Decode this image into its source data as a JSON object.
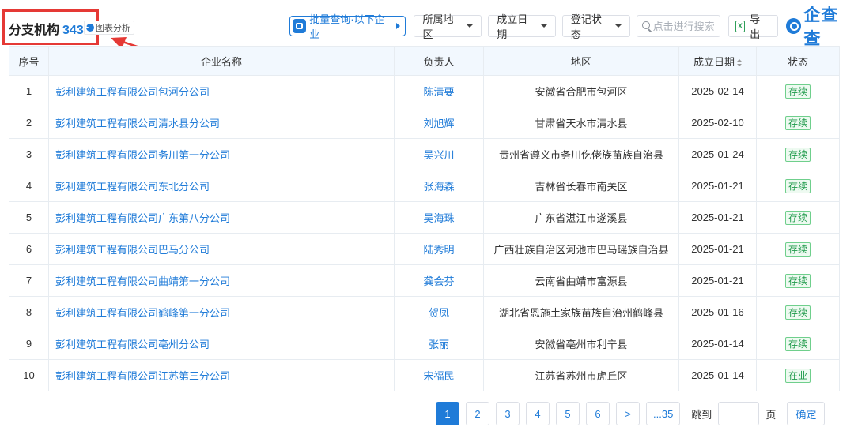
{
  "header": {
    "title": "分支机构",
    "count": "343",
    "chart_link": "图表分析"
  },
  "toolbar": {
    "batch_query": "批量查询·以下企业",
    "filters": [
      "所属地区",
      "成立日期",
      "登记状态"
    ],
    "search_placeholder": "点击进行搜索",
    "export": "导出",
    "xls_glyph": "X",
    "logo": "企查查"
  },
  "table": {
    "headers": [
      "序号",
      "企业名称",
      "负责人",
      "地区",
      "成立日期",
      "状态"
    ],
    "rows": [
      {
        "no": "1",
        "name": "彭利建筑工程有限公司包河分公司",
        "person": "陈清要",
        "region": "安徽省合肥市包河区",
        "date": "2025-02-14",
        "status": "存续"
      },
      {
        "no": "2",
        "name": "彭利建筑工程有限公司清水县分公司",
        "person": "刘旭辉",
        "region": "甘肃省天水市清水县",
        "date": "2025-02-10",
        "status": "存续"
      },
      {
        "no": "3",
        "name": "彭利建筑工程有限公司务川第一分公司",
        "person": "吴兴川",
        "region": "贵州省遵义市务川仡佬族苗族自治县",
        "date": "2025-01-24",
        "status": "存续"
      },
      {
        "no": "4",
        "name": "彭利建筑工程有限公司东北分公司",
        "person": "张海森",
        "region": "吉林省长春市南关区",
        "date": "2025-01-21",
        "status": "存续"
      },
      {
        "no": "5",
        "name": "彭利建筑工程有限公司广东第八分公司",
        "person": "吴海珠",
        "region": "广东省湛江市遂溪县",
        "date": "2025-01-21",
        "status": "存续"
      },
      {
        "no": "6",
        "name": "彭利建筑工程有限公司巴马分公司",
        "person": "陆秀明",
        "region": "广西壮族自治区河池市巴马瑶族自治县",
        "date": "2025-01-21",
        "status": "存续"
      },
      {
        "no": "7",
        "name": "彭利建筑工程有限公司曲靖第一分公司",
        "person": "龚会芬",
        "region": "云南省曲靖市富源县",
        "date": "2025-01-21",
        "status": "存续"
      },
      {
        "no": "8",
        "name": "彭利建筑工程有限公司鹤峰第一分公司",
        "person": "贺凤",
        "region": "湖北省恩施土家族苗族自治州鹤峰县",
        "date": "2025-01-16",
        "status": "存续"
      },
      {
        "no": "9",
        "name": "彭利建筑工程有限公司亳州分公司",
        "person": "张丽",
        "region": "安徽省亳州市利辛县",
        "date": "2025-01-14",
        "status": "存续"
      },
      {
        "no": "10",
        "name": "彭利建筑工程有限公司江苏第三分公司",
        "person": "宋福民",
        "region": "江苏省苏州市虎丘区",
        "date": "2025-01-14",
        "status": "在业"
      }
    ]
  },
  "pagination": {
    "pages": [
      "1",
      "2",
      "3",
      "4",
      "5",
      "6"
    ],
    "current": "1",
    "next": ">",
    "last": "...35",
    "jump_label": "跳到",
    "page_unit": "页",
    "confirm": "确定"
  },
  "colors": {
    "accent": "#1f7bd8",
    "highlight_box": "#e53935",
    "status_green": "#1e9a4a",
    "header_bg": "#f2f8fe"
  }
}
